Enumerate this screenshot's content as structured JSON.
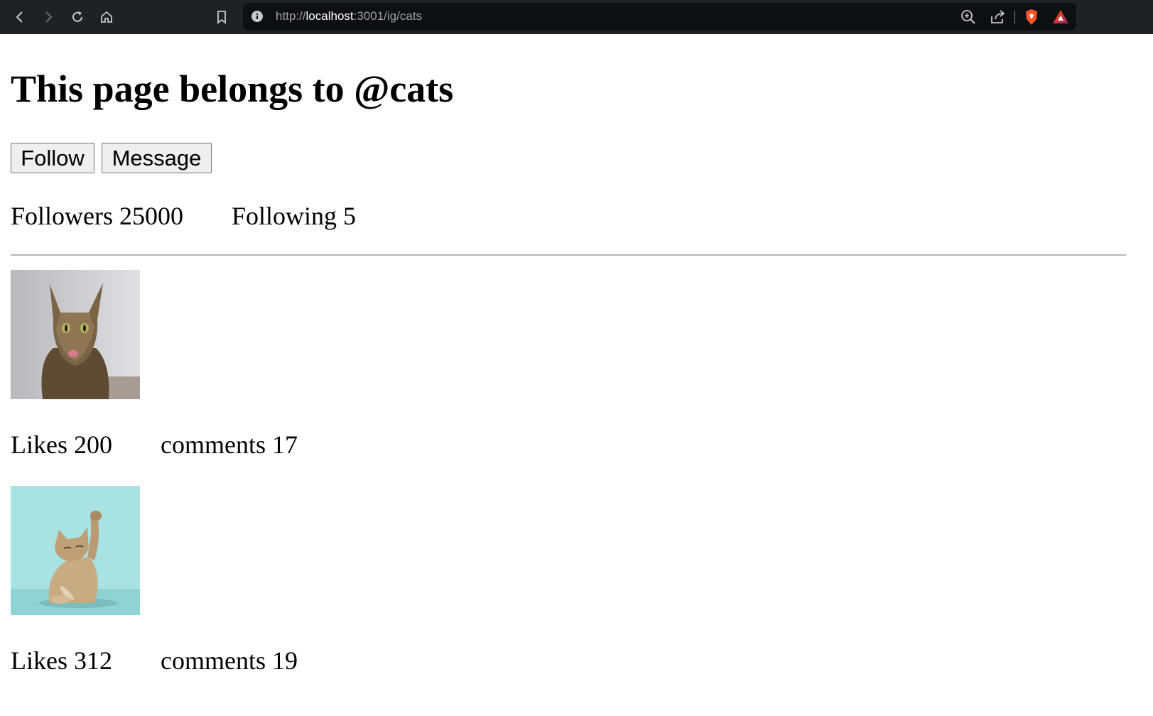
{
  "browser": {
    "url_scheme": "http://",
    "url_host": "localhost",
    "url_rest": ":3001/ig/cats"
  },
  "page": {
    "title": "This page belongs to @cats",
    "buttons": {
      "follow_label": "Follow",
      "message_label": "Message"
    },
    "stats": {
      "followers_label": "Followers",
      "followers_count": "25000",
      "following_label": "Following",
      "following_count": "5"
    },
    "posts": [
      {
        "image": "tabby-cat-licking-lips-photo",
        "likes_label": "Likes",
        "likes": "200",
        "comments_label": "comments",
        "comments": "17"
      },
      {
        "image": "kitten-raising-paw-photo",
        "likes_label": "Likes",
        "likes": "312",
        "comments_label": "comments",
        "comments": "19"
      }
    ]
  },
  "colors": {
    "toolbar_bg": "#202124",
    "omnibox_bg": "#0e0f11",
    "post1_bg": "#cfcfd3",
    "post2_bg": "#a8e2e2"
  }
}
